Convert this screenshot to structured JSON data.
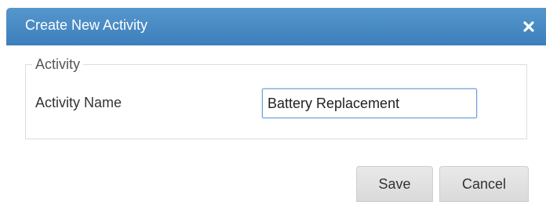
{
  "dialog": {
    "title": "Create New Activity",
    "close_icon": "close-icon",
    "colors": {
      "titlebar": "#4a8ac7",
      "title_text": "#ffffff",
      "input_border": "#6e9fd4",
      "button_bg": "#e2e2e2"
    }
  },
  "fieldset": {
    "legend": "Activity",
    "activity_name_label": "Activity Name",
    "activity_name_value": "Battery Replacement"
  },
  "buttons": {
    "save_label": "Save",
    "cancel_label": "Cancel"
  }
}
